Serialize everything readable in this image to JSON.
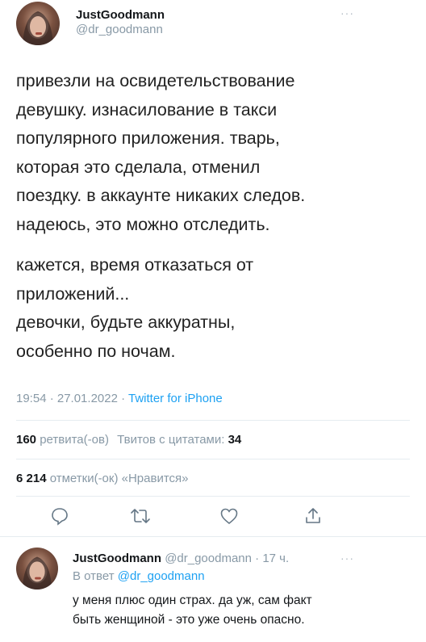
{
  "main_tweet": {
    "author_name": "JustGoodmann",
    "author_handle": "@dr_goodmann",
    "more_icon": "ellipsis-icon",
    "paragraph1": [
      "привезли на освидетельствование",
      "девушку. изнасилование в такси",
      "популярного приложения. тварь,",
      "которая это сделала, отменил",
      "поездку. в аккаунте никаких следов.",
      "надеюсь, это можно отследить."
    ],
    "paragraph2": [
      "кажется, время отказаться от",
      "приложений...",
      "девочки, будьте аккуратны,",
      "особенно по ночам."
    ],
    "time": "19:54 · 27.01.2022 · ",
    "source": "Twitter for iPhone",
    "retweets_count": "160",
    "retweets_label": "ретвита(-ов)",
    "quotes_label": "Твитов с цитатами:",
    "quotes_count": "34",
    "likes_count": "6 214",
    "likes_label": "отметки(-ок) «Нравится»",
    "actions": [
      "reply-icon",
      "retweet-icon",
      "like-icon",
      "share-icon"
    ]
  },
  "reply_tweet": {
    "author_name": "JustGoodmann",
    "author_handle": "@dr_goodmann · 17 ч.",
    "reply_to_prefix": "В ответ ",
    "reply_to_handle": "@dr_goodmann",
    "text": [
      "у меня плюс один страх. да уж, сам факт",
      "быть женщиной - это уже очень опасно."
    ]
  },
  "colors": {
    "link": "#1da1f2",
    "muted": "#8899a6",
    "text": "#14171a"
  }
}
